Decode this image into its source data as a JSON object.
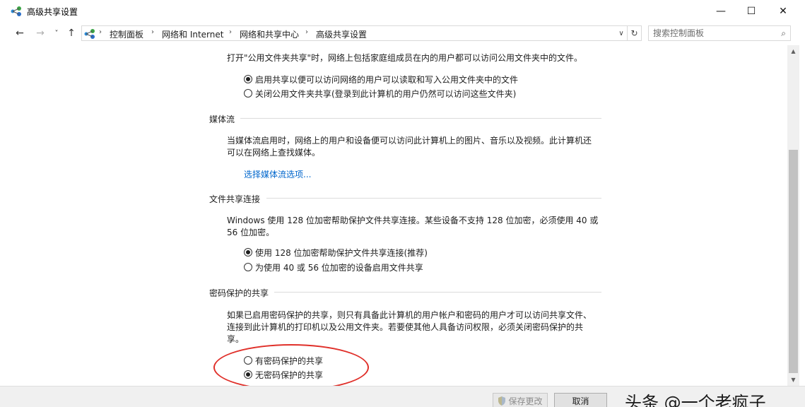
{
  "window": {
    "title": "高级共享设置",
    "minimize_label": "—",
    "maximize_label": "☐",
    "close_label": "✕"
  },
  "nav": {
    "back": "←",
    "forward": "→",
    "recent": "˅",
    "up": "↑"
  },
  "breadcrumb": {
    "items": [
      "控制面板",
      "网络和 Internet",
      "网络和共享中心",
      "高级共享设置"
    ],
    "separator": "›"
  },
  "search": {
    "placeholder": "搜索控制面板"
  },
  "public_folder": {
    "description": "打开\"公用文件夹共享\"时，网络上包括家庭组成员在内的用户都可以访问公用文件夹中的文件。",
    "options": [
      {
        "label": "启用共享以便可以访问网络的用户可以读取和写入公用文件夹中的文件",
        "checked": true
      },
      {
        "label": "关闭公用文件夹共享(登录到此计算机的用户仍然可以访问这些文件夹)",
        "checked": false
      }
    ]
  },
  "media_streaming": {
    "title": "媒体流",
    "description_line1": "当媒体流启用时，网络上的用户和设备便可以访问此计算机上的图片、音乐以及视频。此计算机还",
    "description_line2": "可以在网络上查找媒体。",
    "link": "选择媒体流选项..."
  },
  "file_sharing": {
    "title": "文件共享连接",
    "description_line1": "Windows 使用 128 位加密帮助保护文件共享连接。某些设备不支持 128 位加密，必须使用 40 或",
    "description_line2": "56 位加密。",
    "options": [
      {
        "label": "使用 128 位加密帮助保护文件共享连接(推荐)",
        "checked": true
      },
      {
        "label": "为使用 40 或 56 位加密的设备启用文件共享",
        "checked": false
      }
    ]
  },
  "password_sharing": {
    "title": "密码保护的共享",
    "description_line1": "如果已启用密码保护的共享，则只有具备此计算机的用户帐户和密码的用户才可以访问共享文件、",
    "description_line2": "连接到此计算机的打印机以及公用文件夹。若要使其他人具备访问权限，必须关闭密码保护的共",
    "description_line3": "享。",
    "options": [
      {
        "label": "有密码保护的共享",
        "checked": false
      },
      {
        "label": "无密码保护的共享",
        "checked": true
      }
    ]
  },
  "footer": {
    "save_label": "保存更改",
    "cancel_label": "取消"
  },
  "watermark": "头条 @一个老疯子",
  "colors": {
    "link": "#0066cc",
    "highlight": "#e0302a"
  }
}
